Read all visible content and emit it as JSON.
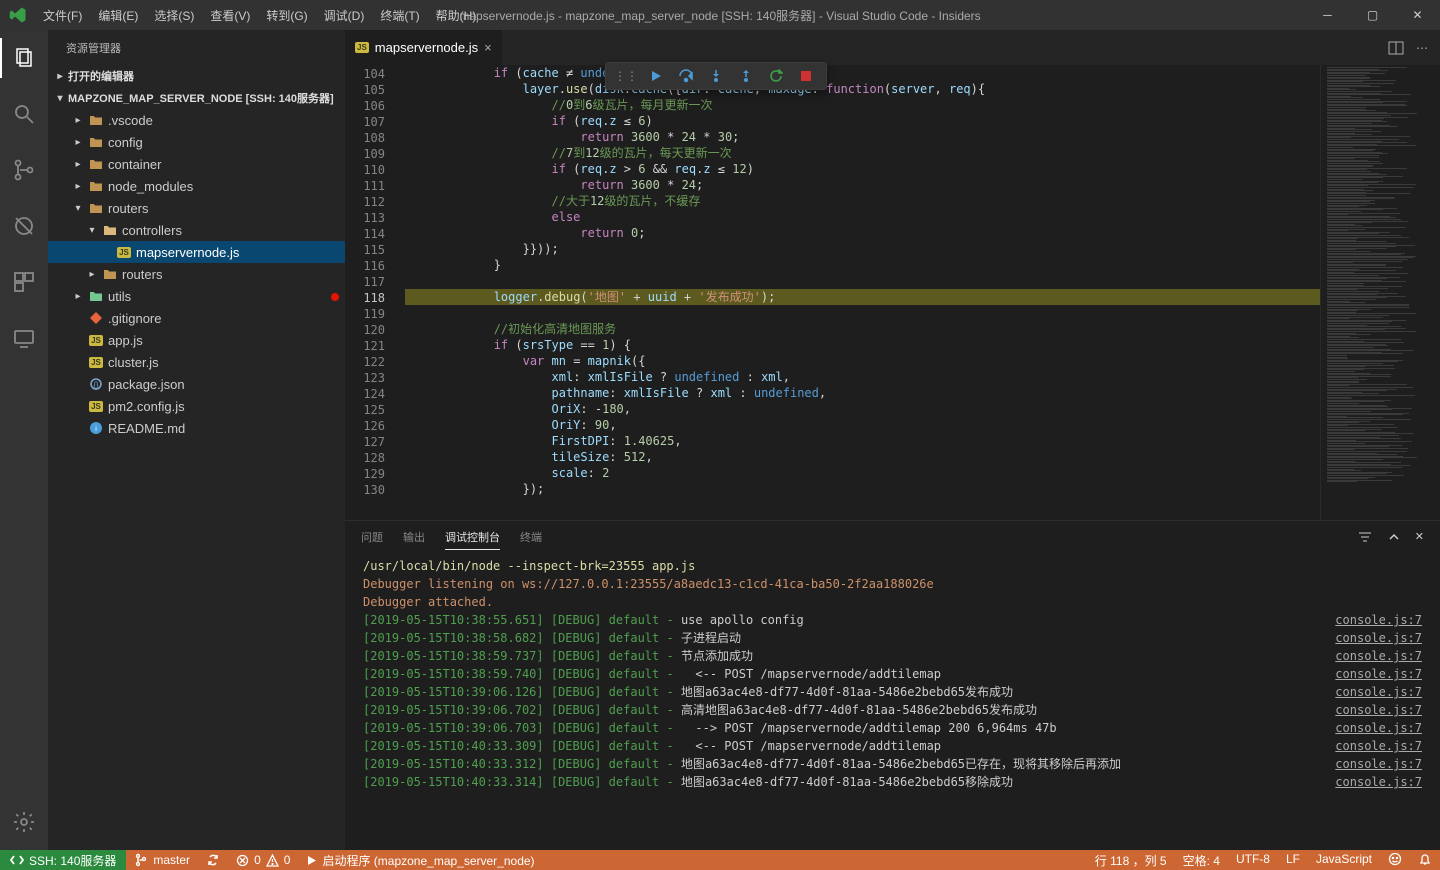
{
  "title": "mapservernode.js - mapzone_map_server_node [SSH: 140服务器] - Visual Studio Code - Insiders",
  "menu": [
    "文件(F)",
    "编辑(E)",
    "选择(S)",
    "查看(V)",
    "转到(G)",
    "调试(D)",
    "终端(T)",
    "帮助(H)"
  ],
  "sidebar_title": "资源管理器",
  "tree": {
    "open_editors": "打开的编辑器",
    "project": "MAPZONE_MAP_SERVER_NODE [SSH: 140服务器]",
    "items": [
      {
        "t": "folder",
        "name": ".vscode",
        "indent": 1
      },
      {
        "t": "folder",
        "name": "config",
        "indent": 1
      },
      {
        "t": "folder",
        "name": "container",
        "indent": 1
      },
      {
        "t": "folder",
        "name": "node_modules",
        "indent": 1
      },
      {
        "t": "folder",
        "name": "routers",
        "indent": 1,
        "open": true
      },
      {
        "t": "folder",
        "name": "controllers",
        "indent": 2,
        "open": true,
        "fcolor": "#dcb67a"
      },
      {
        "t": "file",
        "name": "mapservernode.js",
        "indent": 3,
        "sel": true,
        "ic": "js"
      },
      {
        "t": "folder",
        "name": "routers",
        "indent": 2
      },
      {
        "t": "folder",
        "name": "utils",
        "indent": 1,
        "fcolor": "#73c991"
      },
      {
        "t": "file",
        "name": ".gitignore",
        "indent": 1,
        "ic": "git"
      },
      {
        "t": "file",
        "name": "app.js",
        "indent": 1,
        "ic": "js"
      },
      {
        "t": "file",
        "name": "cluster.js",
        "indent": 1,
        "ic": "js"
      },
      {
        "t": "file",
        "name": "package.json",
        "indent": 1,
        "ic": "json"
      },
      {
        "t": "file",
        "name": "pm2.config.js",
        "indent": 1,
        "ic": "js"
      },
      {
        "t": "file",
        "name": "README.md",
        "indent": 1,
        "ic": "md"
      }
    ]
  },
  "tab": {
    "label": "mapservernode.js"
  },
  "editor": {
    "start": 104,
    "bp_line": 118,
    "highlight_line": 118,
    "lines": [
      "            if (cache ≠ undefined) {",
      "                layer.use(disk.cache({dir: cache, maxage: function(server, req){",
      "                    //0到6级瓦片，每月更新一次",
      "                    if (req.z ≤ 6)",
      "                        return 3600 * 24 * 30;",
      "                    //7到12级的瓦片，每天更新一次",
      "                    if (req.z > 6 && req.z ≤ 12)",
      "                        return 3600 * 24;",
      "                    //大于12级的瓦片，不缓存",
      "                    else",
      "                        return 0;",
      "                }}));",
      "            }",
      "",
      "            logger.debug('地图' + uuid + '发布成功');",
      "",
      "            //初始化高清地图服务",
      "            if (srsType == 1) {",
      "                var mn = mapnik({",
      "                    xml: xmlIsFile ? undefined : xml,",
      "                    pathname: xmlIsFile ? xml : undefined,",
      "                    OriX: -180,",
      "                    OriY: 90,",
      "                    FirstDPI: 1.40625,",
      "                    tileSize: 512,",
      "                    scale: 2",
      "                });"
    ]
  },
  "panel": {
    "tabs": [
      "问题",
      "输出",
      "调试控制台",
      "终端"
    ],
    "active": 2,
    "cmd": "/usr/local/bin/node --inspect-brk=23555 app.js",
    "listening": "Debugger listening on ws://127.0.0.1:23555/a8aedc13-c1cd-41ca-ba50-2f2aa188026e",
    "attached": "Debugger attached.",
    "logs": [
      {
        "ts": "[2019-05-15T10:38:55.651]",
        "lvl": "[DEBUG]",
        "def": "default -",
        "msg": "use apollo config",
        "src": "console.js:7"
      },
      {
        "ts": "[2019-05-15T10:38:58.682]",
        "lvl": "[DEBUG]",
        "def": "default -",
        "msg": "子进程启动",
        "src": "console.js:7"
      },
      {
        "ts": "[2019-05-15T10:38:59.737]",
        "lvl": "[DEBUG]",
        "def": "default -",
        "msg": "节点添加成功",
        "src": "console.js:7"
      },
      {
        "ts": "[2019-05-15T10:38:59.740]",
        "lvl": "[DEBUG]",
        "def": "default -",
        "msg": "  <-- POST /mapservernode/addtilemap",
        "src": "console.js:7"
      },
      {
        "ts": "[2019-05-15T10:39:06.126]",
        "lvl": "[DEBUG]",
        "def": "default -",
        "msg": "地图a63ac4e8-df77-4d0f-81aa-5486e2bebd65发布成功",
        "src": "console.js:7"
      },
      {
        "ts": "[2019-05-15T10:39:06.702]",
        "lvl": "[DEBUG]",
        "def": "default -",
        "msg": "高清地图a63ac4e8-df77-4d0f-81aa-5486e2bebd65发布成功",
        "src": "console.js:7"
      },
      {
        "ts": "[2019-05-15T10:39:06.703]",
        "lvl": "[DEBUG]",
        "def": "default -",
        "msg": "  --> POST /mapservernode/addtilemap 200 6,964ms 47b",
        "src": "console.js:7"
      },
      {
        "ts": "[2019-05-15T10:40:33.309]",
        "lvl": "[DEBUG]",
        "def": "default -",
        "msg": "  <-- POST /mapservernode/addtilemap",
        "src": "console.js:7"
      },
      {
        "ts": "[2019-05-15T10:40:33.312]",
        "lvl": "[DEBUG]",
        "def": "default -",
        "msg": "地图a63ac4e8-df77-4d0f-81aa-5486e2bebd65已存在，现将其移除后再添加",
        "src": "console.js:7"
      },
      {
        "ts": "[2019-05-15T10:40:33.314]",
        "lvl": "[DEBUG]",
        "def": "default -",
        "msg": "地图a63ac4e8-df77-4d0f-81aa-5486e2bebd65移除成功",
        "src": "console.js:7"
      }
    ]
  },
  "status": {
    "remote": "SSH: 140服务器",
    "branch": "master",
    "errors": "0",
    "warnings": "0",
    "launch_prefix": "启动程序 ",
    "launch": "(mapzone_map_server_node)",
    "line": "行 118 ，列 5",
    "spaces": "空格: 4",
    "enc": "UTF-8",
    "eol": "LF",
    "lang": "JavaScript"
  }
}
